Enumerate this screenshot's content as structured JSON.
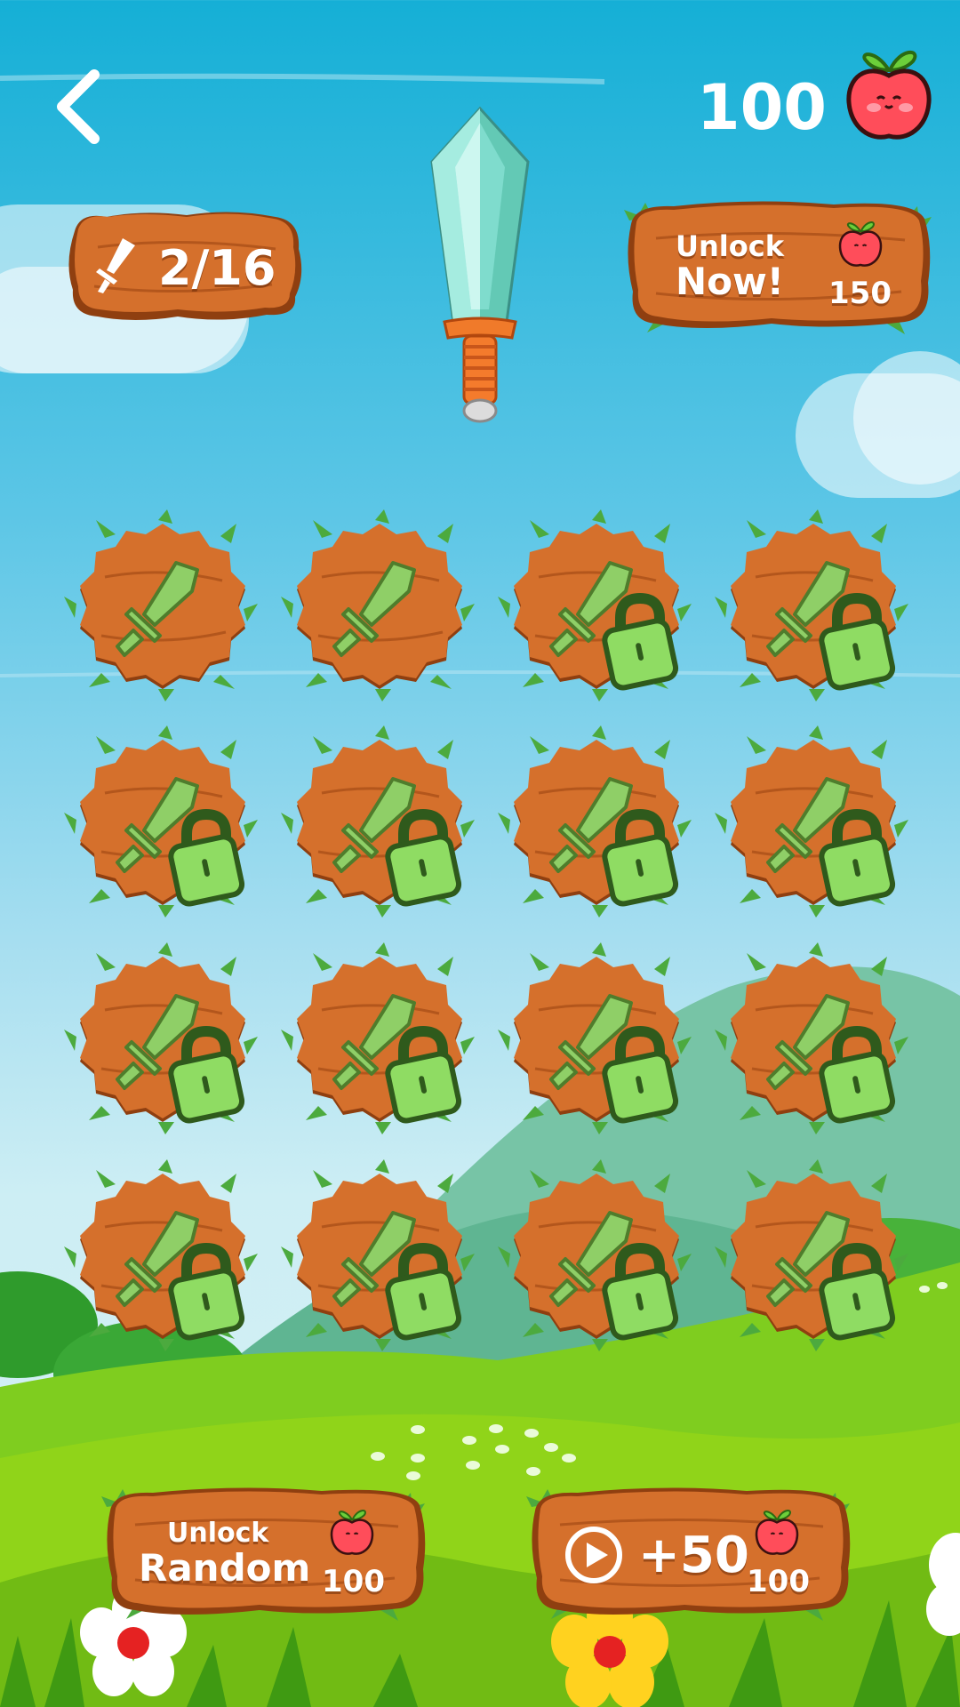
{
  "header": {
    "back_icon": "chevron-left-icon",
    "apples": "100",
    "apple_icon": "apple-icon"
  },
  "progress": {
    "label": "2/16",
    "unlocked": 2,
    "total": 16,
    "icon": "sword-icon"
  },
  "preview": {
    "icon": "crystal-sword-icon"
  },
  "unlock_now": {
    "line1": "Unlock",
    "line2": "Now!",
    "cost": "150",
    "icon": "apple-icon"
  },
  "grid": {
    "tiles": [
      {
        "locked": false
      },
      {
        "locked": false
      },
      {
        "locked": true
      },
      {
        "locked": true
      },
      {
        "locked": true
      },
      {
        "locked": true
      },
      {
        "locked": true
      },
      {
        "locked": true
      },
      {
        "locked": true
      },
      {
        "locked": true
      },
      {
        "locked": true
      },
      {
        "locked": true
      },
      {
        "locked": true
      },
      {
        "locked": true
      },
      {
        "locked": true
      },
      {
        "locked": true
      }
    ]
  },
  "unlock_random": {
    "line1": "Unlock",
    "line2": "Random",
    "cost": "100",
    "icon": "apple-icon"
  },
  "watch_ad": {
    "reward": "+50",
    "cost": "100",
    "icon": "play-icon"
  },
  "colors": {
    "wood": "#d5702c",
    "wood_dark": "#8f3f10",
    "grass": "#4caa3e",
    "lock_green": "#8fdc63",
    "sword_green": "#8fcf67"
  }
}
